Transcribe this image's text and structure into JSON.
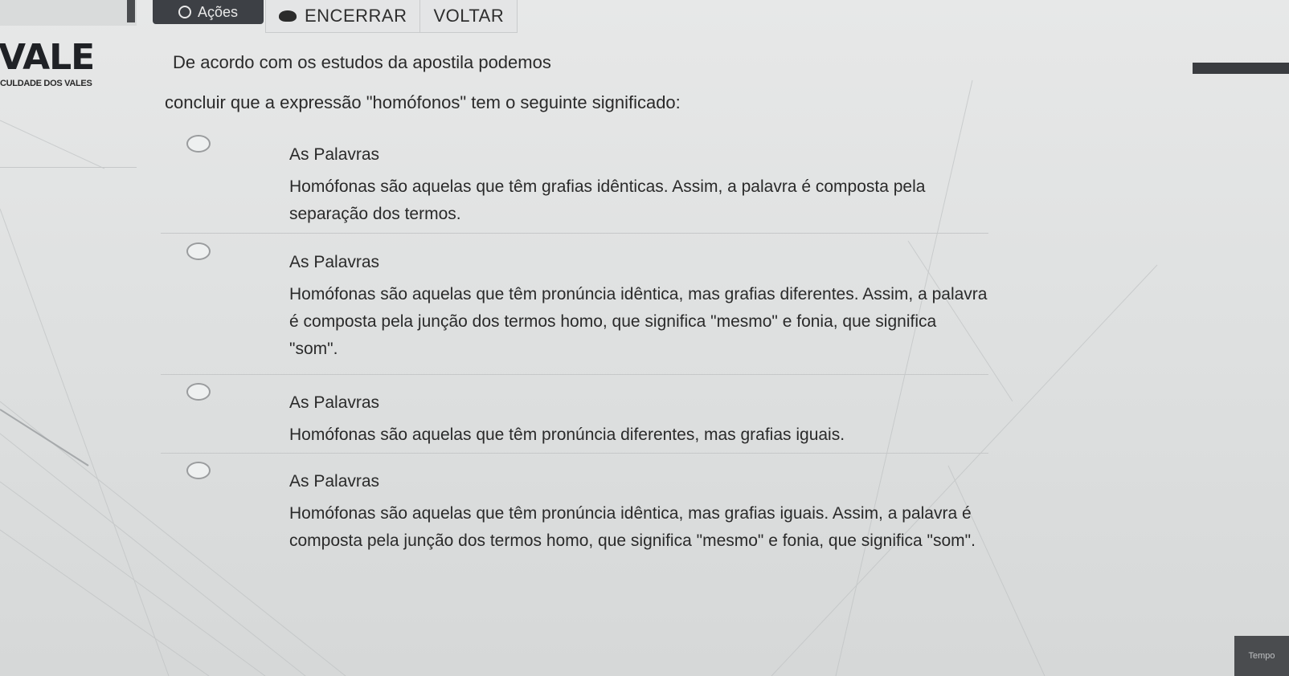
{
  "toolbar": {
    "acoes_label": "Ações",
    "encerrar_label": "ENCERRAR",
    "voltar_label": "VOLTAR"
  },
  "logo": {
    "title": "VALE",
    "subtitle": "CULDADE DOS VALES"
  },
  "question": {
    "line1": "De acordo com os estudos da apostila podemos",
    "line2": "concluir que a expressão \"homófonos\" tem o seguinte significado:"
  },
  "options": [
    {
      "head": "As Palavras",
      "body": "Homófonas são aquelas que têm grafias idênticas. Assim, a palavra é composta pela separação dos termos."
    },
    {
      "head": "As Palavras",
      "body": "Homófonas são aquelas que têm pronúncia idêntica, mas grafias diferentes. Assim, a palavra é composta pela junção dos termos homo, que significa \"mesmo\" e fonia, que significa \"som\"."
    },
    {
      "head": "As Palavras",
      "body": "Homófonas são aquelas que têm pronúncia diferentes, mas grafias iguais."
    },
    {
      "head": "As Palavras",
      "body": "Homófonas são aquelas que têm pronúncia idêntica, mas grafias iguais. Assim, a palavra é composta pela junção dos termos homo, que significa \"mesmo\" e fonia, que significa \"som\"."
    }
  ],
  "timer": {
    "label": "Tempo"
  }
}
